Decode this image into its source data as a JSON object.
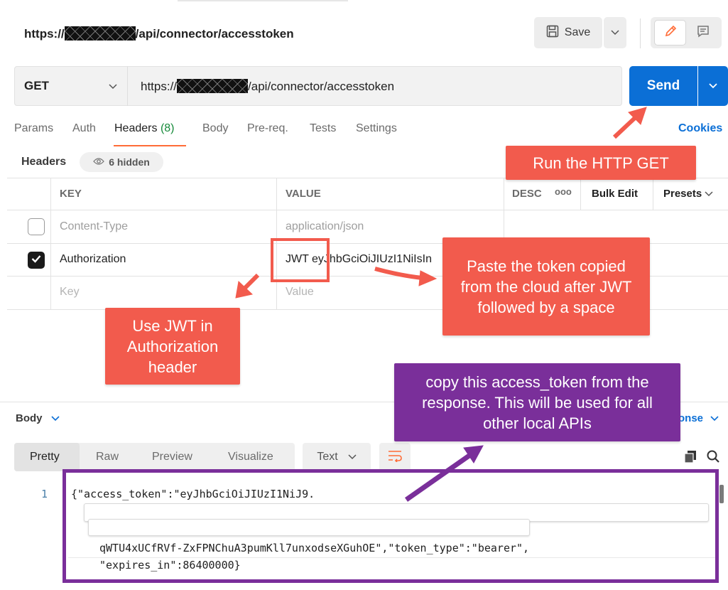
{
  "request": {
    "title_prefix": "https://",
    "title_suffix": "/api/connector/accesstoken",
    "save_label": "Save",
    "method": "GET",
    "url_prefix": "https://",
    "url_suffix": "/api/connector/accesstoken",
    "send_label": "Send"
  },
  "tabs": [
    {
      "label": "Params"
    },
    {
      "label": "Auth"
    },
    {
      "label": "Headers",
      "count": "(8)"
    },
    {
      "label": "Body"
    },
    {
      "label": "Pre-req."
    },
    {
      "label": "Tests"
    },
    {
      "label": "Settings"
    }
  ],
  "cookies_label": "Cookies",
  "headers_section": {
    "label": "Headers",
    "hidden_label": "6 hidden"
  },
  "table": {
    "columns": [
      "KEY",
      "VALUE",
      "DESC"
    ],
    "more_label": "ooo",
    "bulk_edit": "Bulk Edit",
    "presets": "Presets",
    "rows": [
      {
        "checked": false,
        "key": "Content-Type",
        "value": "application/json"
      },
      {
        "checked": true,
        "key": "Authorization",
        "value": "JWT eyJhbGciOiJIUzI1NiIsIn"
      },
      {
        "checked": false,
        "key": "Key",
        "value": "Value"
      }
    ]
  },
  "callouts": {
    "run": "Run the HTTP GET",
    "paste": "Paste the token copied from the cloud after JWT followed by a space",
    "use_jwt": "Use JWT in Authorization header",
    "copy_token": "copy this access_token from the response. This will be used for all other local APIs"
  },
  "response": {
    "body_label": "Body",
    "right_label": "onse",
    "tabs": [
      "Pretty",
      "Raw",
      "Preview",
      "Visualize"
    ],
    "format": "Text",
    "line_number": "1",
    "line1": "{\"access_token\":\"eyJhbGciOiJIUzI1NiJ9.",
    "line_cont": "qWTU4xUCfRVf-ZxFPNChuA3pumKll7unxodseXGuhOE\",\"token_type\":\"bearer\",",
    "line_last": "\"expires_in\":86400000}"
  },
  "colors": {
    "send_blue": "#0b6fd6",
    "callout_red": "#f25b4d",
    "callout_purple": "#7a2f9a",
    "accent_orange": "#ff6c37",
    "headers_count_green": "#168a3a"
  }
}
